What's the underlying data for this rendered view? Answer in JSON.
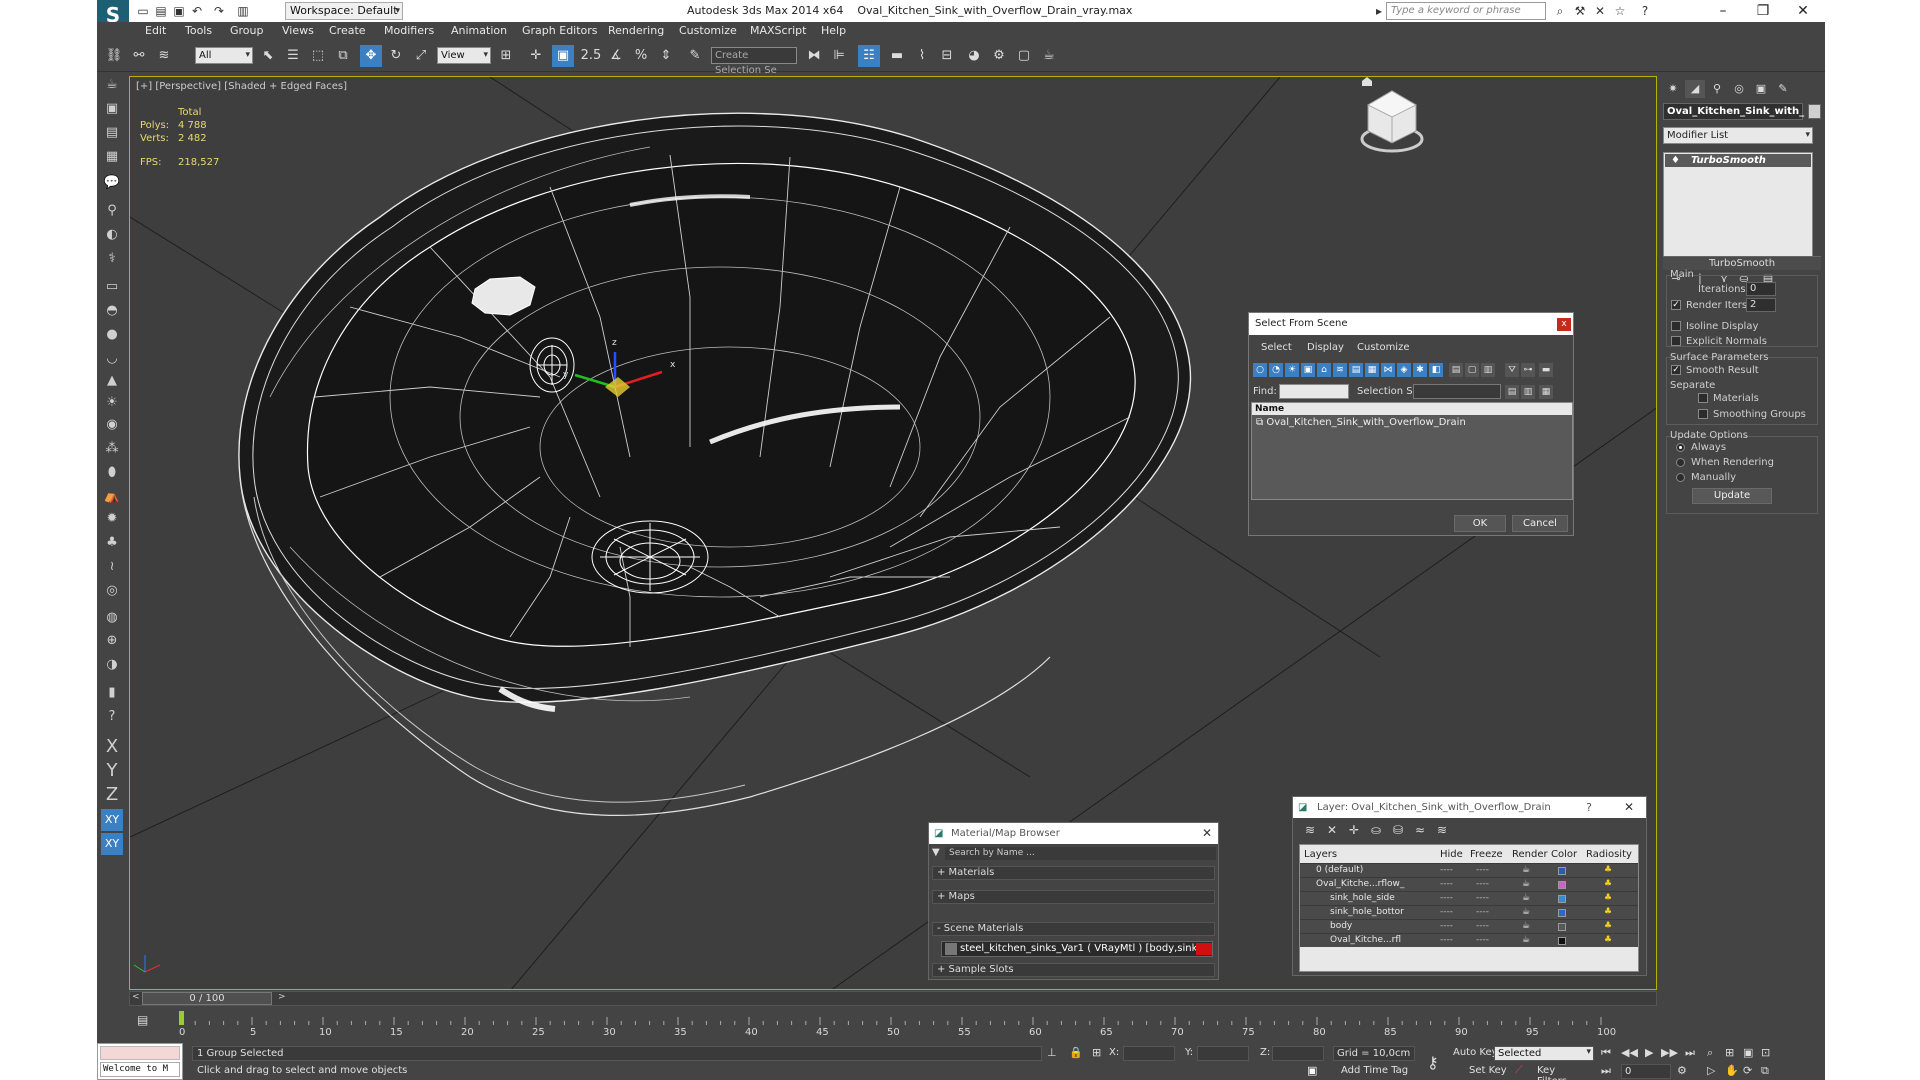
{
  "window": {
    "app_name": "Autodesk 3ds Max  2014 x64",
    "file_name": "Oval_Kitchen_Sink_with_Overflow_Drain_vray.max",
    "workspace": "Workspace: Default",
    "search_placeholder": "Type a keyword or phrase"
  },
  "menu": [
    "Edit",
    "Tools",
    "Group",
    "Views",
    "Create",
    "Modifiers",
    "Animation",
    "Graph Editors",
    "Rendering",
    "Customize",
    "MAXScript",
    "Help"
  ],
  "toolbar": {
    "selection_filter": "All",
    "ref_coord": "View",
    "create_selection_set_placeholder": "Create Selection Se",
    "snap_value": "2.5"
  },
  "viewport": {
    "label": "[+] [Perspective] [Shaded + Edged Faces]",
    "stats": {
      "total_label": "Total",
      "polys_label": "Polys:",
      "polys_value": "4 788",
      "verts_label": "Verts:",
      "verts_value": "2 482",
      "fps_label": "FPS:",
      "fps_value": "218,527"
    },
    "gizmo_axes": [
      "x",
      "y",
      "z"
    ]
  },
  "command_panel": {
    "object_name": "Oval_Kitchen_Sink_with_",
    "modifier_list": "Modifier List",
    "stack": [
      "TurboSmooth"
    ],
    "turbosmooth": {
      "title": "TurboSmooth",
      "main_label": "Main",
      "iterations_label": "Iterations:",
      "iterations_value": "0",
      "render_iters_label": "Render Iters:",
      "render_iters_value": "2",
      "render_iters_checked": true,
      "isoline_label": "Isoline Display",
      "explicit_normals_label": "Explicit Normals",
      "surface_params_label": "Surface Parameters",
      "smooth_result_label": "Smooth Result",
      "smooth_result_checked": true,
      "separate_label": "Separate",
      "materials_label": "Materials",
      "smoothing_groups_label": "Smoothing Groups",
      "update_options_label": "Update Options",
      "always_label": "Always",
      "when_rendering_label": "When Rendering",
      "manually_label": "Manually",
      "update_button": "Update"
    }
  },
  "select_from_scene": {
    "title": "Select From Scene",
    "close_glyph": "x",
    "menu": [
      "Select",
      "Display",
      "Customize"
    ],
    "find_label": "Find:",
    "selection_set_label": "Selection Set:",
    "column_name": "Name",
    "items": [
      "Oval_Kitchen_Sink_with_Overflow_Drain"
    ],
    "ok_button": "OK",
    "cancel_button": "Cancel"
  },
  "material_browser": {
    "title": "Material/Map Browser",
    "search_placeholder": "Search by Name ...",
    "sections": [
      "+ Materials",
      "+ Maps",
      "- Scene Materials",
      "+ Sample Slots"
    ],
    "scene_material": "steel_kitchen_sinks_Var1 ( VRayMtl ) [body,sink_hole_bottom..."
  },
  "layer_dialog": {
    "title": "Layer: Oval_Kitchen_Sink_with_Overflow_Drain",
    "columns": [
      "Layers",
      "Hide",
      "Freeze",
      "Render",
      "Color",
      "Radiosity"
    ],
    "rows": [
      {
        "name": "0 (default)",
        "indent": 0,
        "color": "#2a5db0"
      },
      {
        "name": "Oval_Kitche...rflow_",
        "indent": 0,
        "color": "#d060c8"
      },
      {
        "name": "sink_hole_side",
        "indent": 1,
        "color": "#3a8ad0"
      },
      {
        "name": "sink_hole_bottor",
        "indent": 1,
        "color": "#2a6ac0"
      },
      {
        "name": "body",
        "indent": 1,
        "color": "#585858"
      },
      {
        "name": "Oval_Kitche...rfl",
        "indent": 1,
        "color": "#101010"
      }
    ]
  },
  "timeline": {
    "slider": "0 / 100",
    "ticks": [
      "0",
      "5",
      "10",
      "15",
      "20",
      "25",
      "30",
      "35",
      "40",
      "45",
      "50",
      "55",
      "60",
      "65",
      "70",
      "75",
      "80",
      "85",
      "90",
      "95",
      "100"
    ]
  },
  "status": {
    "maxscript": "Welcome to M",
    "selection": "1 Group Selected",
    "prompt": "Click and drag to select and move objects",
    "x_label": "X:",
    "y_label": "Y:",
    "z_label": "Z:",
    "grid": "Grid = 10,0cm",
    "add_time_tag": "Add Time Tag",
    "auto_key": "Auto Key",
    "set_key": "Set Key",
    "key_mode": "Selected",
    "key_filters": "Key Filters...",
    "frame": "0"
  },
  "colors": {
    "accent": "#3c80c4",
    "viewport_bg": "#3e3e3e",
    "active_border": "#b8b000",
    "stats_text": "#e8d870"
  }
}
